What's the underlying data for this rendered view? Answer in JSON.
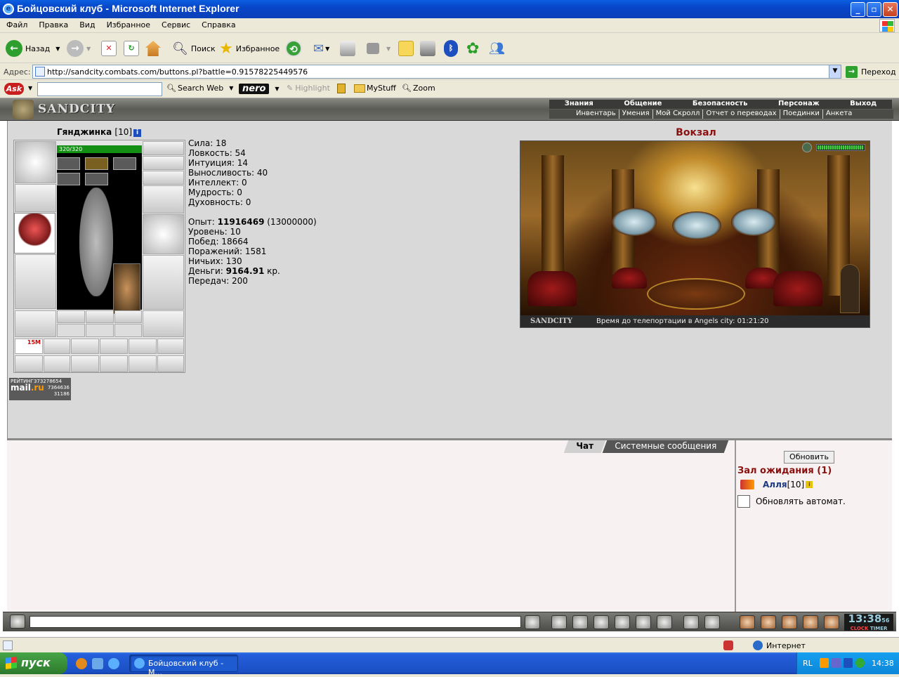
{
  "window": {
    "title": "Бойцовский клуб - Microsoft Internet Explorer"
  },
  "menu": [
    "Файл",
    "Правка",
    "Вид",
    "Избранное",
    "Сервис",
    "Справка"
  ],
  "toolbar": {
    "back": "Назад",
    "search": "Поиск",
    "favorites": "Избранное"
  },
  "address": {
    "label": "Адрес:",
    "url": "http://sandcity.combats.com/buttons.pl?battle=0.91578225449576",
    "go": "Переход"
  },
  "askbar": {
    "search_web": "Search Web",
    "nero": "nero",
    "highlight": "Highlight",
    "mystuff": "MyStuff",
    "zoom": "Zoom"
  },
  "game": {
    "logo": "SANDCITY",
    "nav_top": [
      "Знания",
      "Общение",
      "Безопасность",
      "Персонаж",
      "Выход"
    ],
    "nav_bottom": [
      "Инвентарь",
      "Умения",
      "Мой Скролл",
      "Отчет о переводах",
      "Поединки",
      "Анкета"
    ],
    "character": {
      "name": "Гянджинка",
      "level": "[10]",
      "hp": "320/320",
      "hp_fraction": 1.0,
      "item_timer": "15М"
    },
    "stats": {
      "strength": "Сила: 18",
      "agility": "Ловкость: 54",
      "intuition": "Интуиция: 14",
      "endurance": "Выносливость: 40",
      "intellect": "Интеллект: 0",
      "wisdom": "Мудрость: 0",
      "spirit": "Духовность: 0",
      "exp_label": "Опыт:",
      "exp_value": "11916469",
      "exp_next": "(13000000)",
      "level": "Уровень: 10",
      "wins": "Побед: 18664",
      "losses": "Поражений: 1581",
      "draws": "Ничьих: 130",
      "money_label": "Деньги:",
      "money_value": "9164.91",
      "money_unit": "кр.",
      "transfers": "Передач: 200"
    },
    "rating": {
      "title": "РЕЙТИНГ",
      "n1": "373278654",
      "n2": "7364636",
      "n3": "31186",
      "brand_a": "mail",
      "brand_b": ".ru"
    },
    "location": {
      "title": "Вокзал",
      "logo": "SANDCITY",
      "teleport": "Время до телепортации в Angels city: 01:21:20"
    },
    "chat_tabs": [
      "Чат",
      "Системные сообщения"
    ],
    "room": {
      "refresh": "Обновить",
      "title": "Зал ожидания (1)",
      "user_name": "Алля",
      "user_level": "[10]",
      "auto_refresh": "Обновлять автомат."
    },
    "clock": {
      "time": "13:38",
      "sec": "56",
      "label_clock": "CLOCK",
      "label_timer": "TIMER"
    }
  },
  "statusbar": {
    "zone": "Интернет"
  },
  "taskbar": {
    "start": "пуск",
    "task": "Бойцовский клуб - M...",
    "lang": "RL",
    "time": "14:38"
  }
}
